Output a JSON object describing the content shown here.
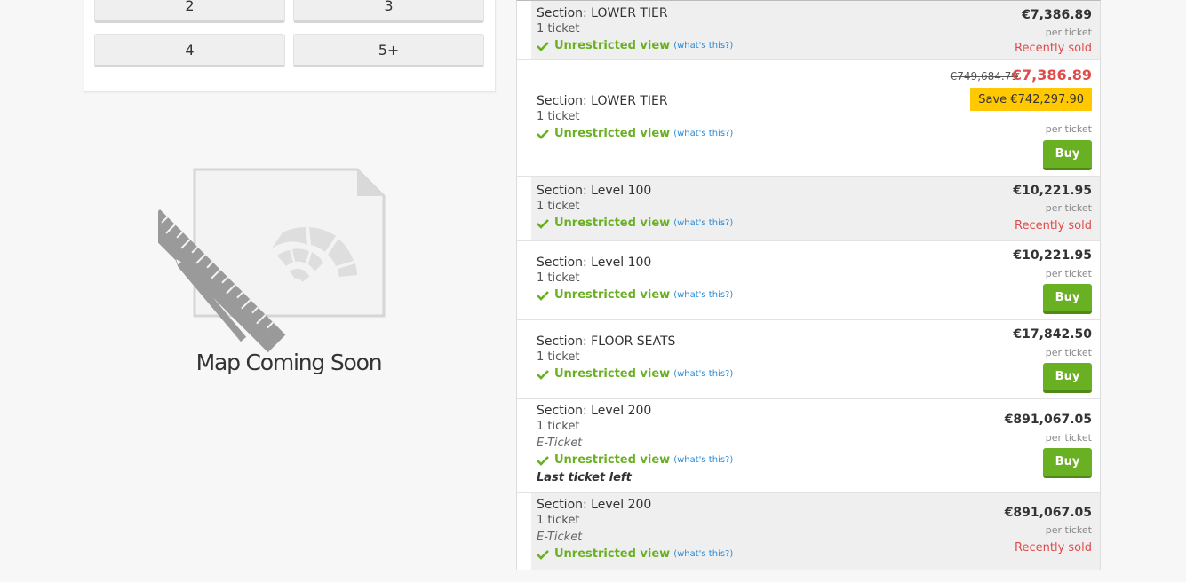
{
  "quantity": {
    "options": [
      "2",
      "3",
      "4",
      "5+"
    ]
  },
  "map": {
    "title": "Map Coming Soon",
    "icon": "map-placeholder-icon"
  },
  "listing": {
    "check_icon": "checkmark-icon",
    "rows": [
      {
        "section": "Section: LOWER TIER",
        "count": "1 ticket",
        "view": "Unrestricted view",
        "whats": "(what's this?)",
        "price": "€7,386.89",
        "per": "per ticket",
        "status": "Recently sold"
      },
      {
        "section": "Section: LOWER TIER",
        "count": "1 ticket",
        "view": "Unrestricted view",
        "whats": "(what's this?)",
        "old_price": "€749,684.79",
        "price": "€7,386.89",
        "save": "Save €742,297.90",
        "per": "per ticket",
        "buy": "Buy"
      },
      {
        "section": "Section: Level 100",
        "count": "1 ticket",
        "view": "Unrestricted view",
        "whats": "(what's this?)",
        "price": "€10,221.95",
        "per": "per ticket",
        "status": "Recently sold"
      },
      {
        "section": "Section: Level 100",
        "count": "1 ticket",
        "view": "Unrestricted view",
        "whats": "(what's this?)",
        "price": "€10,221.95",
        "per": "per ticket",
        "buy": "Buy"
      },
      {
        "section": "Section: FLOOR SEATS",
        "count": "1 ticket",
        "view": "Unrestricted view",
        "whats": "(what's this?)",
        "price": "€17,842.50",
        "per": "per ticket",
        "buy": "Buy"
      },
      {
        "section": "Section: Level 200",
        "count": "1 ticket",
        "etype": "E-Ticket",
        "view": "Unrestricted view",
        "whats": "(what's this?)",
        "note": "Last ticket left",
        "price": "€891,067.05",
        "per": "per ticket",
        "buy": "Buy"
      },
      {
        "section": "Section: Level 200",
        "count": "1 ticket",
        "etype": "E-Ticket",
        "view": "Unrestricted view",
        "whats": "(what's this?)",
        "price": "€891,067.05",
        "per": "per ticket",
        "status": "Recently sold"
      }
    ]
  },
  "colors": {
    "accent_green": "#6ab023",
    "sold_red": "#e04b4b",
    "save_yellow": "#ffc800",
    "link_blue": "#2a8ad4"
  }
}
